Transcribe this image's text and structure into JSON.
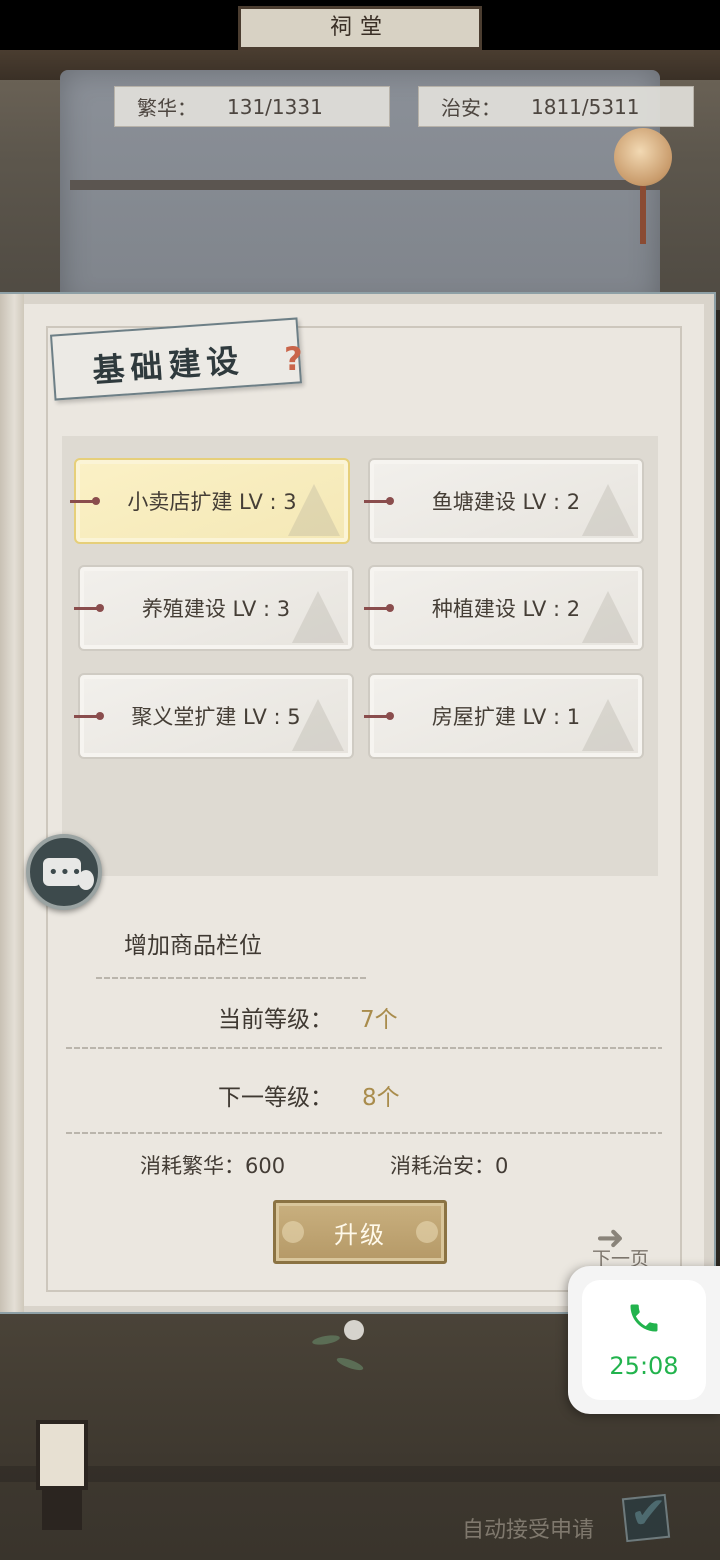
{
  "header": {
    "sign_text": "祠堂",
    "prosperity": {
      "label": "繁华：",
      "value": "131/1331"
    },
    "security": {
      "label": "治安：",
      "value": "1811/5311"
    }
  },
  "panel": {
    "title": "基础建设",
    "buildings": [
      {
        "label": "小卖店扩建 LV : 3",
        "selected": true
      },
      {
        "label": "鱼塘建设 LV : 2",
        "selected": false
      },
      {
        "label": "养殖建设 LV : 3",
        "selected": false
      },
      {
        "label": "种植建设 LV : 2",
        "selected": false
      },
      {
        "label": "聚义堂扩建 LV : 5",
        "selected": false
      },
      {
        "label": "房屋扩建 LV : 1",
        "selected": false
      }
    ],
    "detail": {
      "title": "增加商品栏位",
      "current_label": "当前等级：",
      "current_value": "7个",
      "next_label": "下一等级：",
      "next_value": "8个",
      "cost_prosperity_label": "消耗繁华：",
      "cost_prosperity_value": "600",
      "cost_security_label": "消耗治安：",
      "cost_security_value": "0"
    },
    "upgrade_label": "升级",
    "next_page_label": "下一页"
  },
  "footer": {
    "auto_accept_label": "自动接受申请",
    "auto_accept_checked": true
  },
  "call_widget": {
    "time": "25:08",
    "accent_color": "#22b34d"
  },
  "icons": [
    "chat-icon",
    "phone-icon",
    "checkmark-icon",
    "lantern-icon",
    "help-icon",
    "arrow-right-icon"
  ]
}
